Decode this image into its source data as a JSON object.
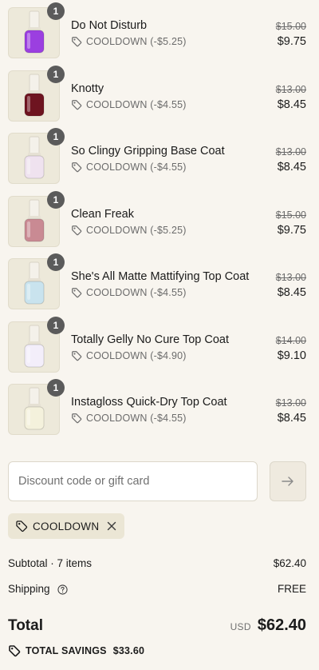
{
  "items": [
    {
      "name": "Do Not Disturb",
      "qty": "1",
      "discount": "COOLDOWN (-$5.25)",
      "original_price": "$15.00",
      "price": "$9.75",
      "polish_color": "#9b3fe0",
      "cap_color": "#f4f1ea"
    },
    {
      "name": "Knotty",
      "qty": "1",
      "discount": "COOLDOWN (-$4.55)",
      "original_price": "$13.00",
      "price": "$8.45",
      "polish_color": "#6e1420",
      "cap_color": "#f4f1ea"
    },
    {
      "name": "So Clingy Gripping Base Coat",
      "qty": "1",
      "discount": "COOLDOWN (-$4.55)",
      "original_price": "$13.00",
      "price": "$8.45",
      "polish_color": "#efe2ef",
      "cap_color": "#f4f1ea"
    },
    {
      "name": "Clean Freak",
      "qty": "1",
      "discount": "COOLDOWN (-$5.25)",
      "original_price": "$15.00",
      "price": "$9.75",
      "polish_color": "#c98a93",
      "cap_color": "#f4f1ea"
    },
    {
      "name": "She's All Matte Mattifying Top Coat",
      "qty": "1",
      "discount": "COOLDOWN (-$4.55)",
      "original_price": "$13.00",
      "price": "$8.45",
      "polish_color": "#c9e3ee",
      "cap_color": "#f4f1ea"
    },
    {
      "name": "Totally Gelly No Cure Top Coat",
      "qty": "1",
      "discount": "COOLDOWN (-$4.90)",
      "original_price": "$14.00",
      "price": "$9.10",
      "polish_color": "#f3eefa",
      "cap_color": "#f4f1ea"
    },
    {
      "name": "Instagloss Quick-Dry Top Coat",
      "qty": "1",
      "discount": "COOLDOWN (-$4.55)",
      "original_price": "$13.00",
      "price": "$8.45",
      "polish_color": "#f4f1dc",
      "cap_color": "#f4f1ea"
    }
  ],
  "discount_field": {
    "placeholder": "Discount code or gift card",
    "value": ""
  },
  "applied_code": {
    "label": "COOLDOWN"
  },
  "summary": {
    "subtotal_label": "Subtotal · 7 items",
    "subtotal_value": "$62.40",
    "shipping_label": "Shipping",
    "shipping_value": "FREE",
    "total_label": "Total",
    "currency": "USD",
    "total_value": "$62.40",
    "savings_label": "TOTAL SAVINGS",
    "savings_value": "$33.60"
  },
  "colors": {
    "background": "#f8f5ef",
    "badge": "#5b5b5b",
    "chip": "#ebe6d5"
  }
}
